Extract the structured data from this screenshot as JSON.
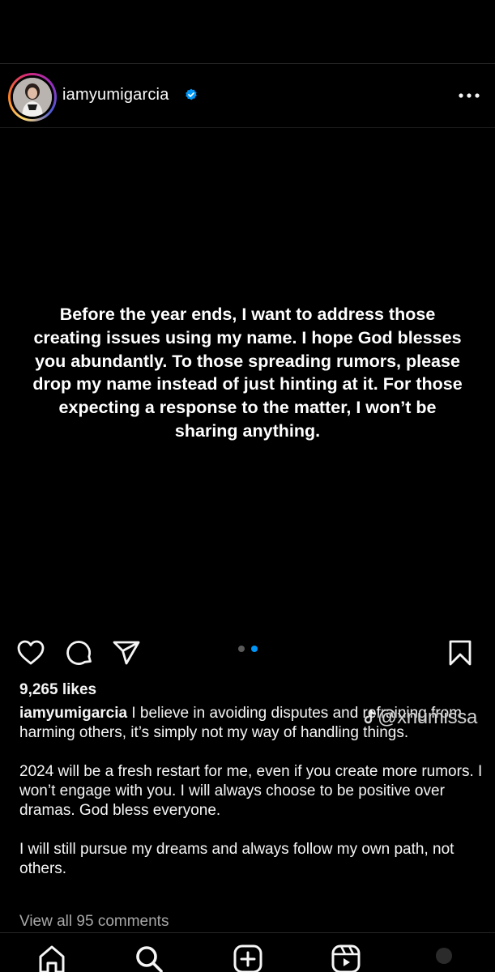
{
  "post": {
    "username": "iamyumigarcia",
    "verified": true,
    "image_text": "Before the year ends, I want to address those creating issues using my name. I hope God blesses you abundantly. To those spreading rumors, please drop my name instead of just hinting at it. For those expecting a response to the matter, I won’t be sharing anything.",
    "carousel": {
      "count": 2,
      "active_index": 1
    },
    "likes": "9,265 likes",
    "caption": {
      "username": "iamyumigarcia",
      "first": "I believe in avoiding disputes and refraining from harming others, it’s simply not my way of handling things.",
      "paragraphs": [
        "2024 will be a fresh restart for me, even if you create more rumors. I won’t engage with you. I will always choose to be positive over dramas. God bless everyone.",
        "I will still pursue my dreams and always follow my own path, not others."
      ]
    },
    "view_comments": "View all 95 comments"
  },
  "watermark": "@xnumissa",
  "icons": {
    "like": "heart-icon",
    "comment": "comment-icon",
    "share": "send-icon",
    "save": "bookmark-icon",
    "more": "more-options-icon",
    "verified": "verified-badge-icon"
  },
  "nav": [
    {
      "name": "home-icon"
    },
    {
      "name": "search-icon"
    },
    {
      "name": "create-icon"
    },
    {
      "name": "reels-icon"
    }
  ],
  "colors": {
    "background": "#000000",
    "text": "#f5f5f5",
    "muted": "#a8a8a8",
    "verified": "#0095f6",
    "dot_active": "#0095f6",
    "dot_inactive": "#5a5a5a"
  }
}
